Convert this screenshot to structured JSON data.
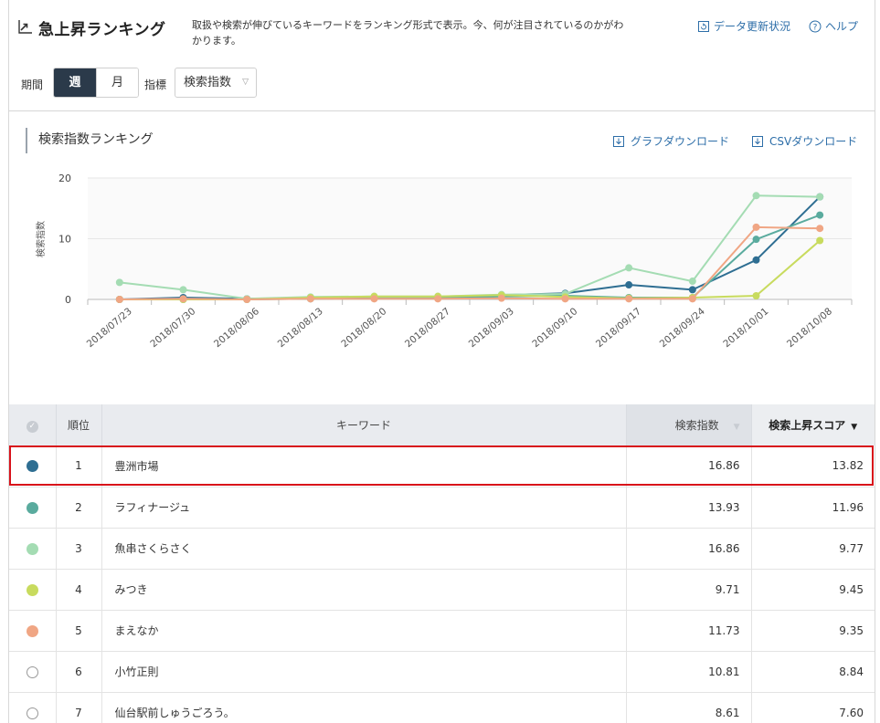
{
  "header": {
    "title": "急上昇ランキング",
    "description": "取扱や検索が伸びているキーワードをランキング形式で表示。今、何が注目されているのかがわかります。",
    "update_status": "データ更新状況",
    "help": "ヘルプ",
    "title_icon": "trending-up-icon",
    "update_icon": "refresh-icon",
    "help_icon": "question-circle-icon"
  },
  "controls": {
    "period_label": "期間",
    "period_options": [
      "週",
      "月"
    ],
    "period_selected": "週",
    "metric_label": "指標",
    "metric_value": "検索指数"
  },
  "chart_panel": {
    "title": "検索指数ランキング",
    "graph_download": "グラフダウンロード",
    "csv_download": "CSVダウンロード"
  },
  "chart_data": {
    "type": "line",
    "ylabel": "検索指数",
    "ylim": [
      0,
      20
    ],
    "yticks": [
      0,
      10,
      20
    ],
    "x": [
      "2018/07/23",
      "2018/07/30",
      "2018/08/06",
      "2018/08/13",
      "2018/08/20",
      "2018/08/27",
      "2018/09/03",
      "2018/09/10",
      "2018/09/17",
      "2018/09/24",
      "2018/10/01",
      "2018/10/08"
    ],
    "grid": true,
    "series": [
      {
        "color": "#2e6e92",
        "values": [
          0,
          0.3,
          0.1,
          0.2,
          0.2,
          0.2,
          0.7,
          1.0,
          2.4,
          1.6,
          6.5,
          16.9
        ]
      },
      {
        "color": "#5aab9e",
        "values": [
          0,
          0,
          0,
          0.1,
          0.2,
          0.2,
          0.5,
          0.6,
          0.3,
          0.3,
          9.9,
          13.9
        ]
      },
      {
        "color": "#a4dcb3",
        "values": [
          2.8,
          1.6,
          0.1,
          0.4,
          0.5,
          0.5,
          0.8,
          0.9,
          5.2,
          3.0,
          17.1,
          16.9
        ]
      },
      {
        "color": "#c8db5e",
        "values": [
          0,
          0,
          0,
          0.3,
          0.5,
          0.5,
          0.7,
          0.4,
          0.2,
          0.3,
          0.6,
          9.7
        ]
      },
      {
        "color": "#f0a684",
        "values": [
          0,
          0.1,
          0,
          0.1,
          0.1,
          0.1,
          0.2,
          0.1,
          0.1,
          0.1,
          11.9,
          11.7
        ]
      }
    ]
  },
  "table": {
    "headers": {
      "rank": "順位",
      "keyword": "キーワード",
      "index": "検索指数",
      "score": "検索上昇スコア"
    },
    "rows": [
      {
        "rank": "1",
        "keyword": "豊洲市場",
        "index": "16.86",
        "score": "13.82",
        "color": "#2e6e92"
      },
      {
        "rank": "2",
        "keyword": "ラフィナージュ",
        "index": "13.93",
        "score": "11.96",
        "color": "#5aab9e"
      },
      {
        "rank": "3",
        "keyword": "魚串さくらさく",
        "index": "16.86",
        "score": "9.77",
        "color": "#a4dcb3"
      },
      {
        "rank": "4",
        "keyword": "みつき",
        "index": "9.71",
        "score": "9.45",
        "color": "#c8db5e"
      },
      {
        "rank": "5",
        "keyword": "まえなか",
        "index": "11.73",
        "score": "9.35",
        "color": "#f0a684"
      },
      {
        "rank": "6",
        "keyword": "小竹正則",
        "index": "10.81",
        "score": "8.84",
        "color": ""
      },
      {
        "rank": "7",
        "keyword": "仙台駅前しゅうごろう。",
        "index": "8.61",
        "score": "7.60",
        "color": ""
      }
    ]
  }
}
